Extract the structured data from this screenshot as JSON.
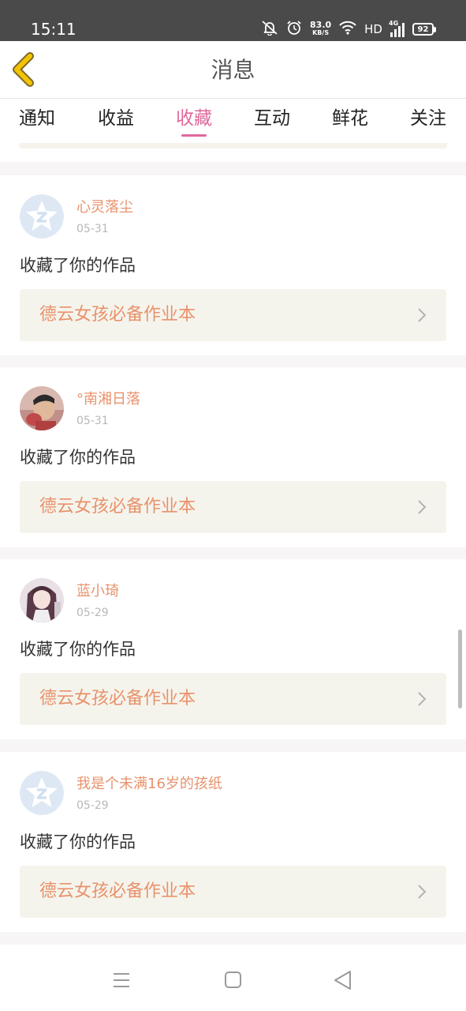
{
  "status_bar": {
    "time": "15:11",
    "net_speed_value": "83.0",
    "net_speed_unit": "KB/S",
    "hd": "HD",
    "network": "4G",
    "battery": "92",
    "icons": [
      "mute-icon",
      "alarm-icon",
      "wifi-icon",
      "signal-icon",
      "battery-icon"
    ]
  },
  "header": {
    "title": "消息",
    "back_icon": "back-chevron-icon",
    "back_color": "#f5c400"
  },
  "tabs": [
    {
      "label": "通知",
      "active": false
    },
    {
      "label": "收益",
      "active": false
    },
    {
      "label": "收藏",
      "active": true
    },
    {
      "label": "互动",
      "active": false
    },
    {
      "label": "鲜花",
      "active": false
    },
    {
      "label": "关注",
      "active": false
    }
  ],
  "colors": {
    "accent": "#e0689c",
    "username": "#e8926c",
    "work_title": "#e8926c",
    "work_box_bg": "#f5f4ec"
  },
  "messages": [
    {
      "username": "心灵落尘",
      "date": "05-31",
      "action": "收藏了你的作品",
      "work_title": "德云女孩必备作业本",
      "avatar": "default-avatar-icon"
    },
    {
      "username": "°南湘日落",
      "date": "05-31",
      "action": "收藏了你的作品",
      "work_title": "德云女孩必备作业本",
      "avatar": "user-photo-avatar"
    },
    {
      "username": "蓝小琦",
      "date": "05-29",
      "action": "收藏了你的作品",
      "work_title": "德云女孩必备作业本",
      "avatar": "anime-girl-avatar"
    },
    {
      "username": "我是个未满16岁的孩纸",
      "date": "05-29",
      "action": "收藏了你的作品",
      "work_title": "德云女孩必备作业本",
      "avatar": "default-avatar-icon"
    }
  ],
  "nav_bar": {
    "icons": [
      "menu-icon",
      "home-square-icon",
      "back-triangle-icon"
    ]
  }
}
